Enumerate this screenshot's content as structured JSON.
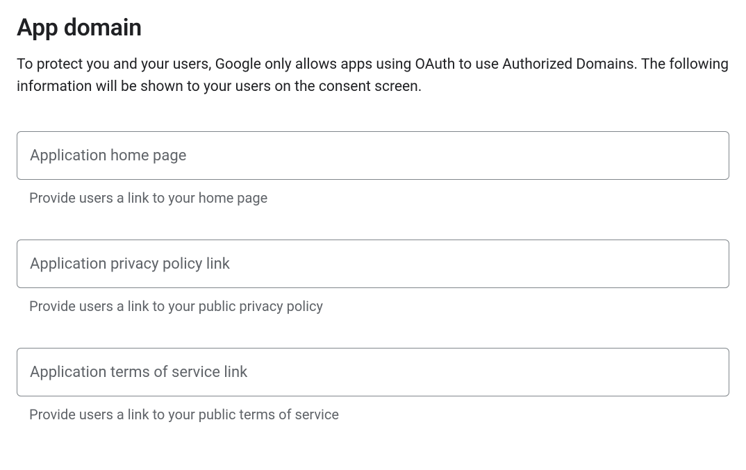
{
  "section": {
    "title": "App domain",
    "description": "To protect you and your users, Google only allows apps using OAuth to use Authorized Domains. The following information will be shown to your users on the consent screen."
  },
  "fields": {
    "home_page": {
      "placeholder": "Application home page",
      "helper": "Provide users a link to your home page",
      "value": ""
    },
    "privacy_policy": {
      "placeholder": "Application privacy policy link",
      "helper": "Provide users a link to your public privacy policy",
      "value": ""
    },
    "terms_of_service": {
      "placeholder": "Application terms of service link",
      "helper": "Provide users a link to your public terms of service",
      "value": ""
    }
  }
}
